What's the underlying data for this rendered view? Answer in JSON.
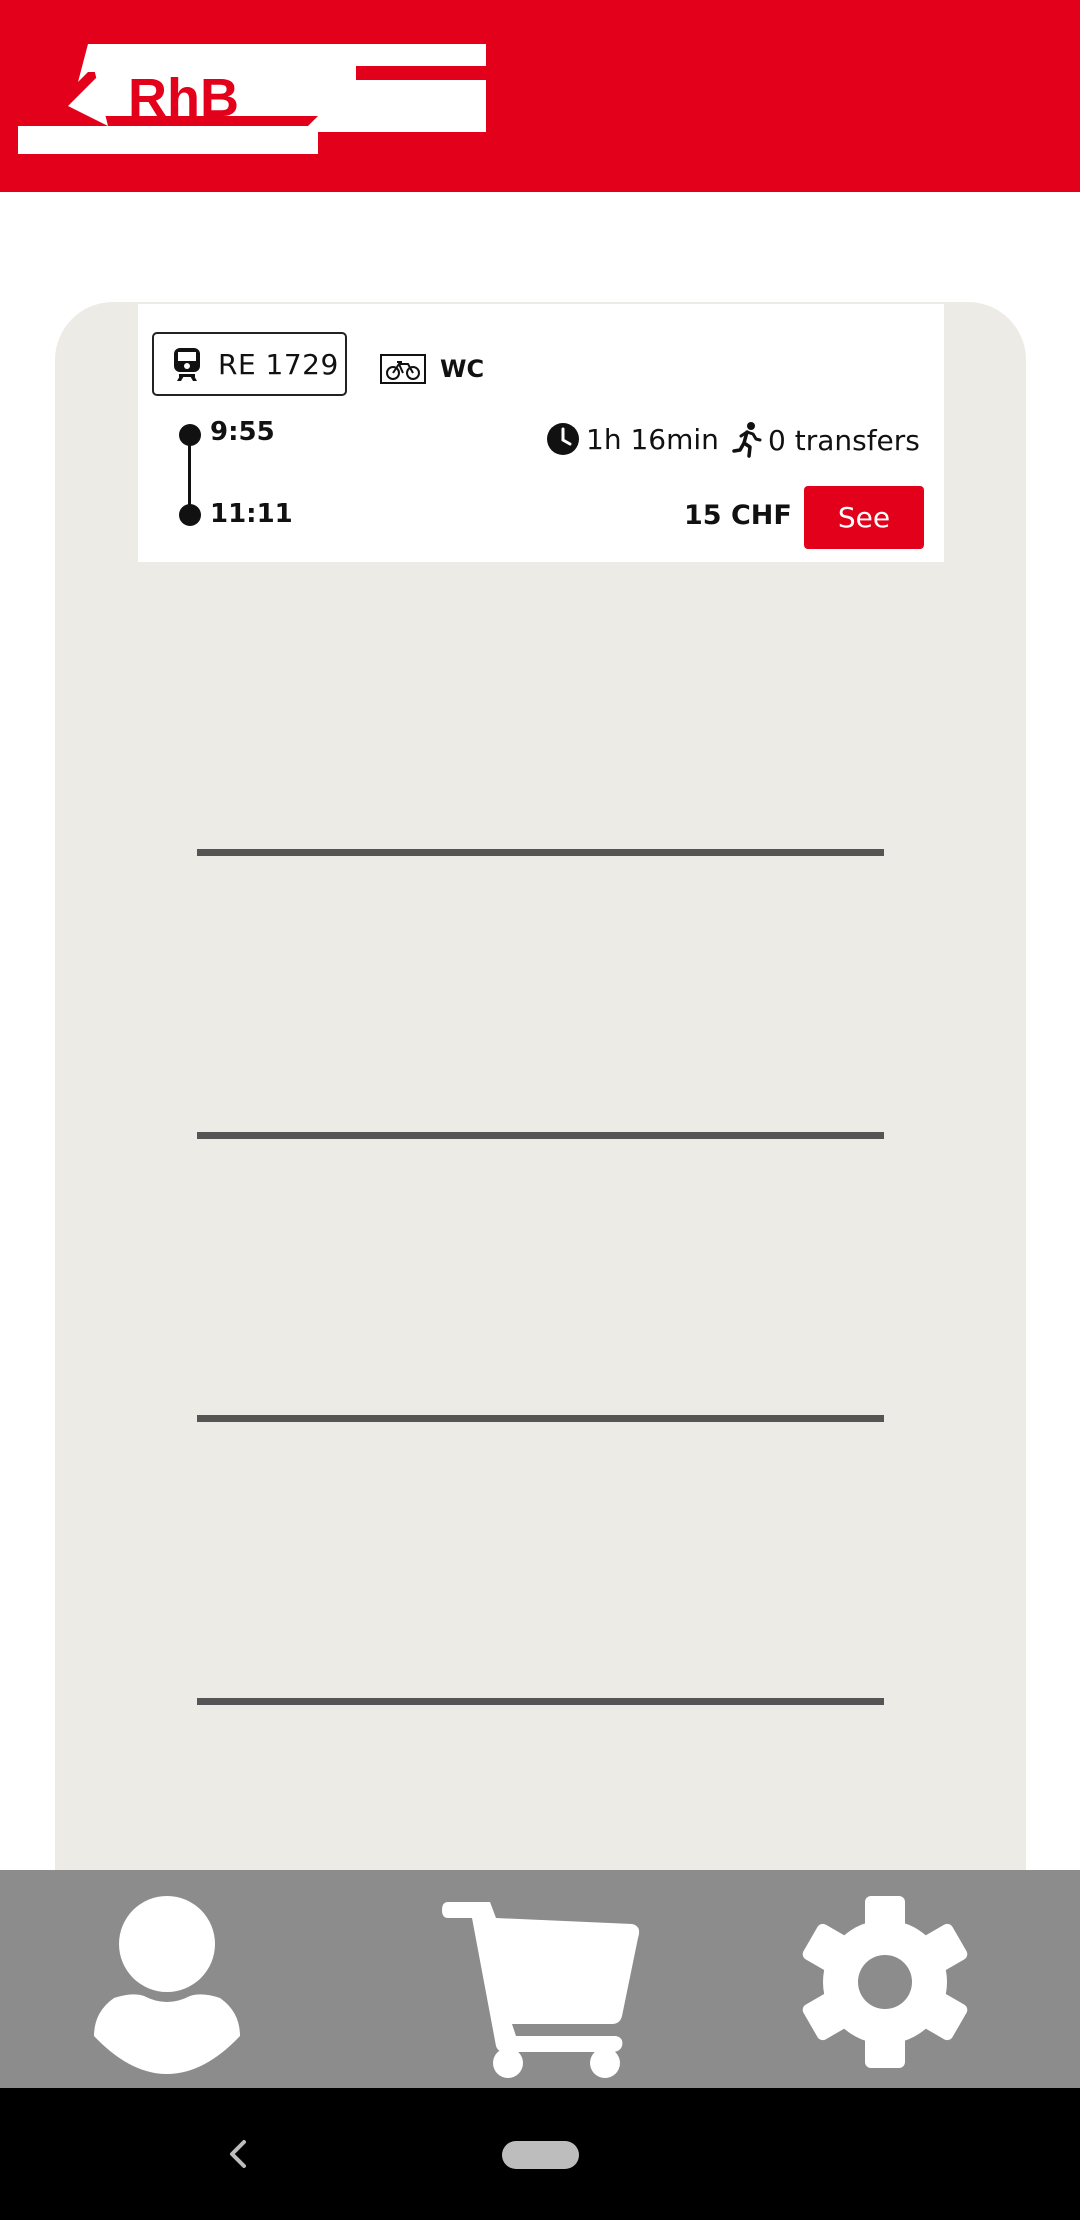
{
  "header": {
    "logo_text": "RhB",
    "brand_color": "#e2001a"
  },
  "connection": {
    "train_label": "RE 1729",
    "train_icon": "train-icon",
    "amenities": {
      "bike_icon": "bicycle-icon",
      "wc_label": "WC"
    },
    "departure_time": "9:55",
    "arrival_time": "11:11",
    "duration": "1h 16min",
    "transfers": "0 transfers",
    "price": "15 CHF",
    "see_label": "See"
  },
  "bottom_nav": {
    "items": [
      {
        "icon": "user-icon"
      },
      {
        "icon": "cart-icon"
      },
      {
        "icon": "gear-icon"
      }
    ]
  },
  "system_nav": {
    "back_icon": "back-chevron-icon"
  }
}
